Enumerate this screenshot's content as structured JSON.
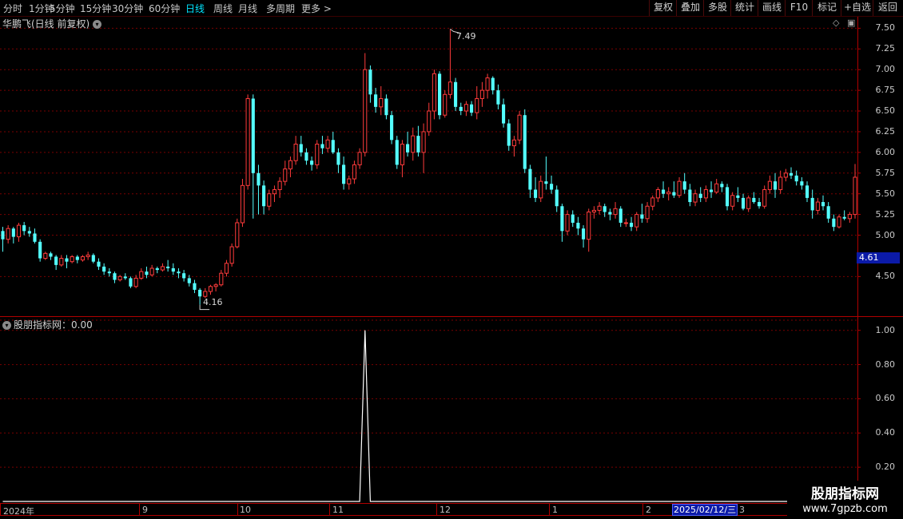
{
  "toolbar": {
    "periods": [
      "分时",
      "1分钟",
      "5分钟",
      "15分钟",
      "30分钟",
      "60分钟",
      "日线",
      "周线",
      "月线",
      "多周期",
      "更多 >"
    ],
    "active_period": "日线",
    "right_buttons": [
      "复权",
      "叠加",
      "多股",
      "统计",
      "画线",
      "F10",
      "标记",
      "+自选",
      "返回"
    ]
  },
  "main_chart": {
    "title": "华鹏飞(日线 前复权)",
    "price_axis": [
      "7.50",
      "7.25",
      "7.00",
      "6.75",
      "6.50",
      "6.25",
      "6.00",
      "5.75",
      "5.50",
      "5.25",
      "5.00",
      "4.50"
    ],
    "high_marker": "7.49",
    "low_marker": "4.16",
    "current_price_tag": "4.61"
  },
  "indicator": {
    "title": "股朋指标网：0.00",
    "axis": [
      "1.00",
      "0.80",
      "0.60",
      "0.40",
      "0.20"
    ]
  },
  "dates": [
    "2024年",
    "9",
    "10",
    "11",
    "12",
    "1",
    "2",
    "3"
  ],
  "selected_date": "2025/02/12/三",
  "watermark": {
    "line1": "股朋指标网",
    "line2": "www.7gpzb.com"
  },
  "colors": {
    "up": "#ff3b3b",
    "down": "#54ffff",
    "grid": "#7a0000",
    "border": "#b00000",
    "active": "#00e5ff"
  },
  "chart_data": {
    "type": "candlestick",
    "ylim": [
      4.05,
      7.6
    ],
    "candles": [
      [
        5.05,
        5.1,
        4.8,
        4.95
      ],
      [
        4.95,
        5.12,
        4.9,
        5.08
      ],
      [
        5.08,
        5.1,
        4.9,
        4.98
      ],
      [
        4.98,
        5.15,
        4.92,
        5.12
      ],
      [
        5.12,
        5.16,
        5.0,
        5.05
      ],
      [
        5.05,
        5.1,
        4.98,
        5.02
      ],
      [
        5.02,
        5.08,
        4.9,
        4.92
      ],
      [
        4.92,
        4.95,
        4.68,
        4.72
      ],
      [
        4.72,
        4.8,
        4.7,
        4.78
      ],
      [
        4.78,
        4.8,
        4.7,
        4.74
      ],
      [
        4.74,
        4.76,
        4.58,
        4.64
      ],
      [
        4.64,
        4.76,
        4.62,
        4.72
      ],
      [
        4.72,
        4.76,
        4.6,
        4.68
      ],
      [
        4.68,
        4.76,
        4.66,
        4.74
      ],
      [
        4.74,
        4.76,
        4.66,
        4.7
      ],
      [
        4.7,
        4.76,
        4.68,
        4.74
      ],
      [
        4.74,
        4.8,
        4.7,
        4.76
      ],
      [
        4.76,
        4.78,
        4.66,
        4.68
      ],
      [
        4.68,
        4.72,
        4.58,
        4.62
      ],
      [
        4.62,
        4.66,
        4.52,
        4.56
      ],
      [
        4.56,
        4.6,
        4.5,
        4.54
      ],
      [
        4.54,
        4.56,
        4.42,
        4.46
      ],
      [
        4.46,
        4.52,
        4.44,
        4.5
      ],
      [
        4.5,
        4.54,
        4.46,
        4.48
      ],
      [
        4.48,
        4.5,
        4.36,
        4.38
      ],
      [
        4.38,
        4.52,
        4.36,
        4.48
      ],
      [
        4.48,
        4.6,
        4.46,
        4.56
      ],
      [
        4.56,
        4.62,
        4.48,
        4.52
      ],
      [
        4.52,
        4.64,
        4.5,
        4.6
      ],
      [
        4.6,
        4.62,
        4.54,
        4.58
      ],
      [
        4.58,
        4.66,
        4.56,
        4.62
      ],
      [
        4.62,
        4.7,
        4.56,
        4.6
      ],
      [
        4.6,
        4.66,
        4.52,
        4.56
      ],
      [
        4.56,
        4.6,
        4.48,
        4.54
      ],
      [
        4.54,
        4.58,
        4.44,
        4.48
      ],
      [
        4.48,
        4.52,
        4.38,
        4.42
      ],
      [
        4.42,
        4.46,
        4.3,
        4.34
      ],
      [
        4.34,
        4.36,
        4.16,
        4.26
      ],
      [
        4.26,
        4.36,
        4.24,
        4.32
      ],
      [
        4.32,
        4.4,
        4.28,
        4.38
      ],
      [
        4.38,
        4.42,
        4.32,
        4.4
      ],
      [
        4.4,
        4.58,
        4.38,
        4.54
      ],
      [
        4.54,
        4.7,
        4.5,
        4.66
      ],
      [
        4.66,
        4.9,
        4.62,
        4.86
      ],
      [
        4.86,
        5.2,
        4.84,
        5.15
      ],
      [
        5.15,
        5.68,
        5.1,
        5.6
      ],
      [
        5.6,
        6.7,
        5.55,
        6.65
      ],
      [
        6.65,
        6.7,
        5.2,
        5.75
      ],
      [
        5.75,
        5.85,
        5.25,
        5.6
      ],
      [
        5.6,
        5.66,
        5.25,
        5.35
      ],
      [
        5.35,
        5.55,
        5.3,
        5.5
      ],
      [
        5.5,
        5.6,
        5.4,
        5.55
      ],
      [
        5.55,
        5.7,
        5.45,
        5.65
      ],
      [
        5.65,
        5.9,
        5.6,
        5.8
      ],
      [
        5.8,
        5.95,
        5.7,
        5.9
      ],
      [
        5.9,
        6.2,
        5.85,
        6.1
      ],
      [
        6.1,
        6.2,
        5.95,
        6.0
      ],
      [
        6.0,
        6.05,
        5.85,
        5.9
      ],
      [
        5.9,
        5.95,
        5.78,
        5.85
      ],
      [
        5.85,
        6.15,
        5.8,
        6.1
      ],
      [
        6.1,
        6.2,
        5.98,
        6.05
      ],
      [
        6.05,
        6.2,
        6.0,
        6.15
      ],
      [
        6.15,
        6.25,
        5.98,
        6.0
      ],
      [
        6.0,
        6.05,
        5.75,
        5.85
      ],
      [
        5.85,
        5.95,
        5.55,
        5.62
      ],
      [
        5.62,
        5.72,
        5.55,
        5.68
      ],
      [
        5.68,
        5.9,
        5.62,
        5.85
      ],
      [
        5.85,
        6.05,
        5.8,
        6.0
      ],
      [
        6.0,
        7.2,
        5.95,
        7.0
      ],
      [
        7.0,
        7.05,
        6.6,
        6.7
      ],
      [
        6.7,
        6.78,
        6.48,
        6.55
      ],
      [
        6.55,
        6.8,
        6.45,
        6.65
      ],
      [
        6.65,
        6.7,
        6.4,
        6.45
      ],
      [
        6.45,
        6.5,
        6.1,
        6.15
      ],
      [
        6.15,
        6.2,
        5.8,
        5.85
      ],
      [
        5.85,
        6.15,
        5.7,
        6.1
      ],
      [
        6.1,
        6.25,
        5.95,
        6.0
      ],
      [
        6.0,
        6.3,
        5.9,
        6.2
      ],
      [
        6.2,
        6.32,
        5.95,
        6.0
      ],
      [
        6.0,
        6.35,
        5.75,
        6.25
      ],
      [
        6.25,
        6.6,
        6.2,
        6.5
      ],
      [
        6.5,
        7.0,
        6.4,
        6.95
      ],
      [
        6.95,
        6.98,
        6.4,
        6.45
      ],
      [
        6.45,
        6.75,
        6.42,
        6.7
      ],
      [
        6.7,
        7.49,
        6.65,
        6.85
      ],
      [
        6.85,
        6.9,
        6.5,
        6.55
      ],
      [
        6.55,
        6.6,
        6.45,
        6.5
      ],
      [
        6.5,
        6.62,
        6.44,
        6.58
      ],
      [
        6.58,
        6.62,
        6.44,
        6.48
      ],
      [
        6.48,
        6.8,
        6.4,
        6.65
      ],
      [
        6.65,
        6.85,
        6.55,
        6.75
      ],
      [
        6.75,
        6.95,
        6.65,
        6.9
      ],
      [
        6.9,
        6.92,
        6.7,
        6.75
      ],
      [
        6.75,
        6.82,
        6.52,
        6.58
      ],
      [
        6.58,
        6.65,
        6.3,
        6.35
      ],
      [
        6.35,
        6.4,
        6.02,
        6.08
      ],
      [
        6.08,
        6.2,
        5.95,
        6.15
      ],
      [
        6.15,
        6.5,
        6.1,
        6.45
      ],
      [
        6.45,
        6.52,
        5.75,
        5.8
      ],
      [
        5.8,
        5.85,
        5.45,
        5.55
      ],
      [
        5.55,
        5.7,
        5.4,
        5.45
      ],
      [
        5.45,
        5.72,
        5.4,
        5.65
      ],
      [
        5.65,
        5.95,
        5.55,
        5.62
      ],
      [
        5.62,
        5.72,
        5.5,
        5.55
      ],
      [
        5.55,
        5.6,
        5.28,
        5.35
      ],
      [
        5.35,
        5.38,
        4.92,
        5.05
      ],
      [
        5.05,
        5.3,
        5.0,
        5.25
      ],
      [
        5.25,
        5.3,
        5.1,
        5.15
      ],
      [
        5.15,
        5.22,
        5.0,
        5.08
      ],
      [
        5.08,
        5.12,
        4.85,
        4.95
      ],
      [
        4.95,
        5.32,
        4.8,
        5.28
      ],
      [
        5.28,
        5.35,
        5.2,
        5.3
      ],
      [
        5.3,
        5.4,
        5.25,
        5.35
      ],
      [
        5.35,
        5.38,
        5.22,
        5.28
      ],
      [
        5.28,
        5.32,
        5.18,
        5.25
      ],
      [
        5.25,
        5.4,
        5.2,
        5.32
      ],
      [
        5.32,
        5.35,
        5.1,
        5.15
      ],
      [
        5.15,
        5.2,
        5.1,
        5.15
      ],
      [
        5.15,
        5.22,
        5.05,
        5.1
      ],
      [
        5.1,
        5.28,
        5.05,
        5.25
      ],
      [
        5.25,
        5.38,
        5.15,
        5.2
      ],
      [
        5.2,
        5.4,
        5.15,
        5.35
      ],
      [
        5.35,
        5.48,
        5.3,
        5.45
      ],
      [
        5.45,
        5.58,
        5.4,
        5.55
      ],
      [
        5.55,
        5.65,
        5.45,
        5.5
      ],
      [
        5.5,
        5.58,
        5.42,
        5.52
      ],
      [
        5.52,
        5.65,
        5.45,
        5.48
      ],
      [
        5.48,
        5.7,
        5.45,
        5.65
      ],
      [
        5.65,
        5.75,
        5.5,
        5.55
      ],
      [
        5.55,
        5.62,
        5.35,
        5.4
      ],
      [
        5.4,
        5.55,
        5.35,
        5.5
      ],
      [
        5.5,
        5.58,
        5.4,
        5.45
      ],
      [
        5.45,
        5.6,
        5.4,
        5.55
      ],
      [
        5.55,
        5.65,
        5.45,
        5.52
      ],
      [
        5.52,
        5.68,
        5.5,
        5.62
      ],
      [
        5.62,
        5.65,
        5.52,
        5.58
      ],
      [
        5.58,
        5.62,
        5.3,
        5.35
      ],
      [
        5.35,
        5.52,
        5.3,
        5.48
      ],
      [
        5.48,
        5.58,
        5.4,
        5.45
      ],
      [
        5.45,
        5.5,
        5.3,
        5.32
      ],
      [
        5.32,
        5.48,
        5.28,
        5.45
      ],
      [
        5.45,
        5.52,
        5.38,
        5.4
      ],
      [
        5.4,
        5.45,
        5.32,
        5.35
      ],
      [
        5.35,
        5.6,
        5.32,
        5.55
      ],
      [
        5.55,
        5.72,
        5.5,
        5.65
      ],
      [
        5.65,
        5.75,
        5.45,
        5.55
      ],
      [
        5.55,
        5.78,
        5.5,
        5.7
      ],
      [
        5.7,
        5.8,
        5.65,
        5.75
      ],
      [
        5.75,
        5.82,
        5.68,
        5.72
      ],
      [
        5.72,
        5.78,
        5.6,
        5.65
      ],
      [
        5.65,
        5.7,
        5.55,
        5.6
      ],
      [
        5.6,
        5.65,
        5.4,
        5.45
      ],
      [
        5.45,
        5.55,
        5.2,
        5.3
      ],
      [
        5.3,
        5.45,
        5.25,
        5.4
      ],
      [
        5.4,
        5.48,
        5.3,
        5.35
      ],
      [
        5.35,
        5.4,
        5.15,
        5.2
      ],
      [
        5.2,
        5.25,
        5.05,
        5.1
      ],
      [
        5.1,
        5.25,
        5.08,
        5.22
      ],
      [
        5.22,
        5.3,
        5.18,
        5.2
      ],
      [
        5.2,
        5.28,
        5.15,
        5.25
      ],
      [
        5.25,
        5.86,
        5.2,
        5.7
      ]
    ],
    "indicator_values": [
      0,
      0,
      0,
      0,
      0,
      0,
      0,
      0,
      0,
      0,
      0,
      0,
      0,
      0,
      0,
      0,
      0,
      0,
      0,
      0,
      0,
      0,
      0,
      0,
      0,
      0,
      0,
      0,
      0,
      0,
      0,
      0,
      0,
      0,
      0,
      0,
      0,
      0,
      0,
      0,
      0,
      0,
      0,
      0,
      0,
      0,
      0,
      0,
      0,
      0,
      0,
      0,
      0,
      0,
      0,
      0,
      0,
      0,
      0,
      0,
      0,
      0,
      0,
      0,
      0,
      0,
      0,
      0,
      1,
      0,
      0,
      0,
      0,
      0,
      0,
      0,
      0,
      0,
      0,
      0,
      0,
      0,
      0,
      0,
      0,
      0,
      0,
      0,
      0,
      0,
      0,
      0,
      0,
      0,
      0,
      0,
      0,
      0,
      0,
      0,
      0,
      0,
      0,
      0,
      0,
      0,
      0,
      0,
      0,
      0,
      0,
      0,
      0,
      0,
      0,
      0,
      0,
      0,
      0,
      0,
      0,
      0,
      0,
      0,
      0,
      0,
      0,
      0,
      0,
      0,
      0,
      0,
      0,
      0,
      0,
      0,
      0,
      0,
      0,
      0,
      0,
      0,
      0,
      0,
      0,
      0,
      0,
      0,
      0,
      0,
      0,
      0,
      0,
      0,
      0,
      0,
      0,
      0,
      0,
      0,
      0
    ],
    "indicator_ylim": [
      0,
      1.05
    ]
  }
}
